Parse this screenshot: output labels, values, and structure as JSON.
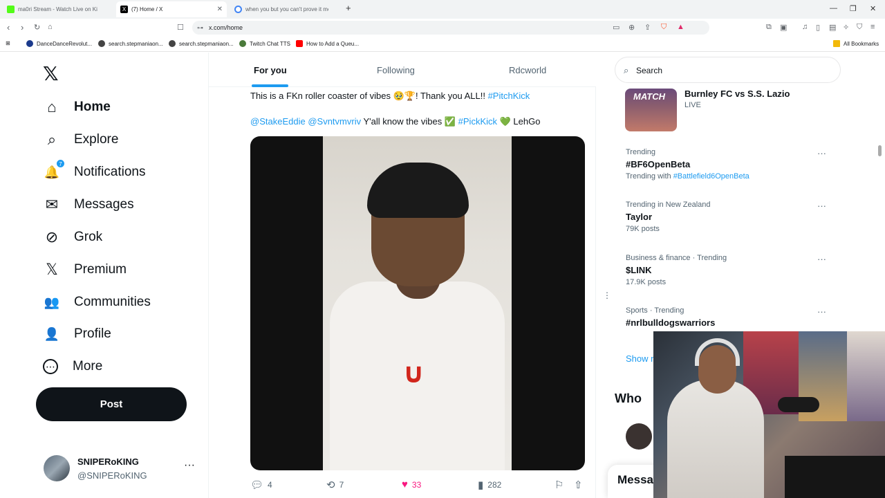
{
  "browser": {
    "tabs": [
      {
        "title": "ma0ri Stream - Watch Live on Ki",
        "color": "#53fc18"
      },
      {
        "title": "(7) Home / X",
        "color": "#000000"
      },
      {
        "title": "when you but you can't prove it me",
        "color": "#4285f4"
      }
    ],
    "url": "x.com/home",
    "bookmarks": [
      "DanceDanceRevolut...",
      "search.stepmaniaon...",
      "search.stepmaniaon...",
      "Twitch Chat TTS",
      "How to Add a Queu..."
    ],
    "all_bookmarks": "All Bookmarks"
  },
  "sidebar": {
    "logo": "𝕏",
    "items": [
      {
        "label": "Home",
        "icon": "⌂"
      },
      {
        "label": "Explore",
        "icon": "⌕"
      },
      {
        "label": "Notifications",
        "icon": "🔔",
        "badge": "7"
      },
      {
        "label": "Messages",
        "icon": "✉"
      },
      {
        "label": "Grok",
        "icon": "⊘"
      },
      {
        "label": "Premium",
        "icon": "𝕏"
      },
      {
        "label": "Communities",
        "icon": "👥"
      },
      {
        "label": "Profile",
        "icon": "👤"
      },
      {
        "label": "More",
        "icon": "⋯"
      }
    ],
    "post_label": "Post",
    "user": {
      "name": "SNIPERoKING",
      "handle": "@SNIPERoKING",
      "more": "···"
    }
  },
  "timeline": {
    "tabs": [
      "For you",
      "Following",
      "Rdcworld"
    ],
    "tweet": {
      "line1_text": "This is a FKn roller coaster of vibes 🥹🏆! Thank you ALL!! ",
      "line1_tag": "#PitchKick",
      "line2_mention1": "@StakeEddie",
      "line2_mention2": "@Svntvmvriv",
      "line2_text": " Y'all know the vibes ✅ ",
      "line2_tag": "#PickKick",
      "line2_end": " 💚 LehGo",
      "replies": "4",
      "reposts": "7",
      "likes": "33",
      "views": "282"
    }
  },
  "right": {
    "search_placeholder": "Search",
    "match": {
      "img_text": "MATCH",
      "title": "Burnley FC vs S.S. Lazio",
      "status": "LIVE"
    },
    "trends": [
      {
        "context": "Trending",
        "name": "#BF6OpenBeta",
        "sub_prefix": "Trending with ",
        "sub_link": "#Battlefield6OpenBeta"
      },
      {
        "context": "Trending in New Zealand",
        "name": "Taylor",
        "sub": "79K posts"
      },
      {
        "context": "Business & finance · Trending",
        "name": "$LINK",
        "sub": "17.9K posts"
      },
      {
        "context": "Sports · Trending",
        "name": "#nrlbulldogswarriors",
        "sub": ""
      }
    ],
    "show_more": "Show m",
    "who_title": "Who",
    "messages": "Messa"
  },
  "colors": {
    "accent": "#1d9bf0",
    "like": "#f91880",
    "text": "#0f1419",
    "muted": "#536471"
  }
}
